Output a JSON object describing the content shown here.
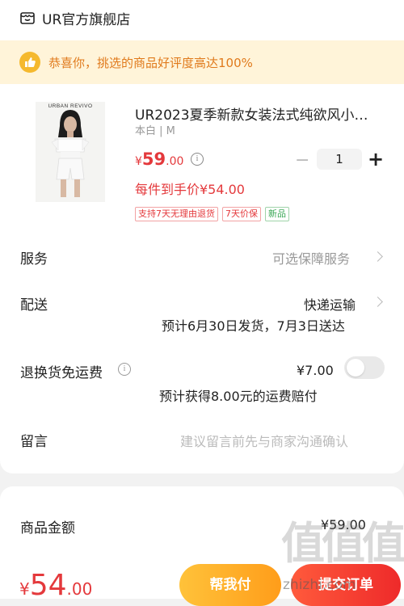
{
  "shop": {
    "name": "UR官方旗舰店",
    "icon": "shop-icon"
  },
  "banner": {
    "icon": "thumbs-up-icon",
    "text": "恭喜你，挑选的商品好评度高达100%"
  },
  "product": {
    "brand_image_text": "URBAN REVIVO",
    "title": "UR2023夏季新款女装法式纯欲风小…",
    "sku": "本白 | M",
    "price_currency": "¥",
    "price_int": "59",
    "price_dec": ".00",
    "quantity": "1",
    "unit_price": "每件到手价¥54.00",
    "tags": [
      "支持7天无理由退货",
      "7天价保",
      "新品"
    ]
  },
  "service": {
    "label": "服务",
    "value": "可选保障服务"
  },
  "delivery": {
    "label": "配送",
    "method": "快递运输",
    "estimate": "预计6月30日发货，7月3日送达"
  },
  "return_shipping": {
    "label": "退换货免运费",
    "price": "¥7.00",
    "note": "预计获得8.00元的运费赔付",
    "enabled": false
  },
  "message": {
    "label": "留言",
    "placeholder": "建议留言前先与商家沟通确认"
  },
  "summary": {
    "label": "商品金额",
    "value": "¥59.00"
  },
  "footer": {
    "total_currency": "¥",
    "total_int": "54",
    "total_dec": ".00",
    "help_pay": "帮我付",
    "submit": "提交订单"
  },
  "watermark": {
    "chars": "值值值",
    "url": "zhizhi.com"
  },
  "colors": {
    "price_red": "#e4393c",
    "banner_bg": "#fff4d9",
    "banner_text": "#e07a1c",
    "help_btn": "#ffb02e",
    "submit_btn": "#ee2a2a"
  }
}
